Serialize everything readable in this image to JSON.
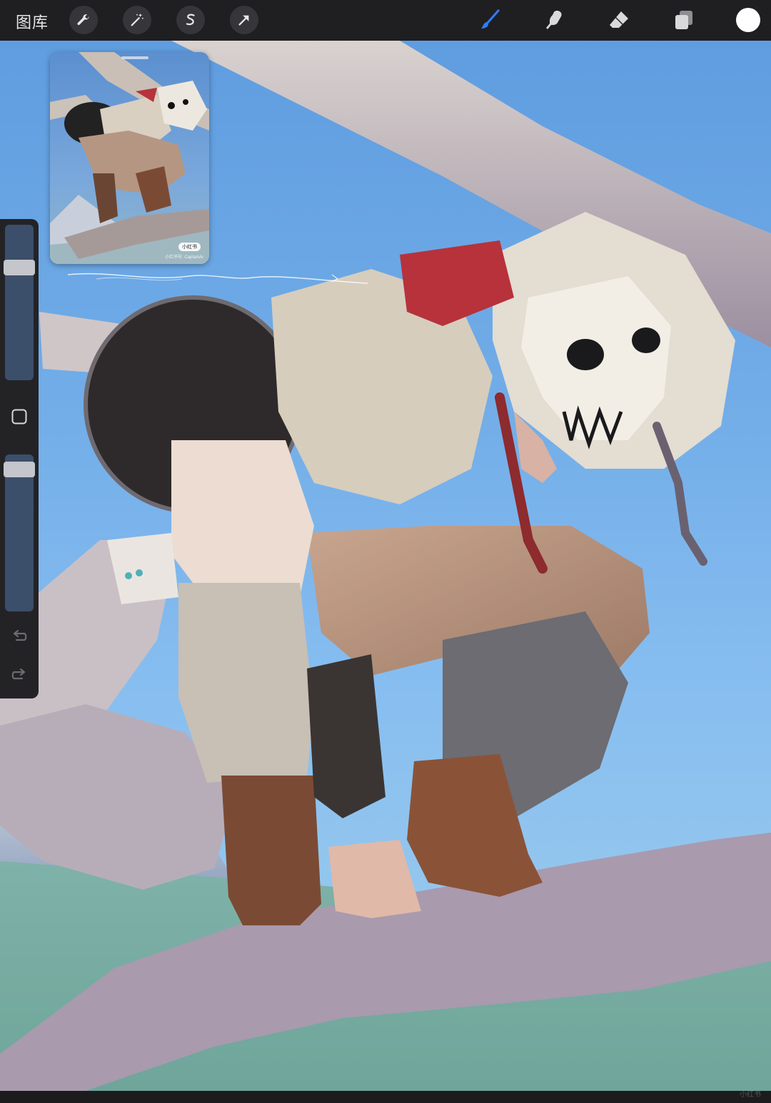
{
  "toolbar": {
    "gallery_label": "图库",
    "left_tools": [
      {
        "name": "actions",
        "icon": "wrench-icon"
      },
      {
        "name": "adjustments",
        "icon": "magic-wand-icon"
      },
      {
        "name": "selection",
        "icon": "selection-s-icon"
      },
      {
        "name": "transform",
        "icon": "arrow-cursor-icon"
      }
    ],
    "right_tools": [
      {
        "name": "brush",
        "icon": "brush-icon",
        "active": true,
        "color": "#2f7bf5"
      },
      {
        "name": "smudge",
        "icon": "smudge-finger-icon",
        "active": false
      },
      {
        "name": "eraser",
        "icon": "eraser-icon",
        "active": false
      },
      {
        "name": "layers",
        "icon": "layers-icon",
        "active": false
      }
    ],
    "current_color": "#ffffff"
  },
  "reference_window": {
    "badge": "小红书",
    "credit": "小红书号: CaptainAr"
  },
  "sidebar": {
    "brush_size_level": 0.75,
    "opacity_level": 0.95,
    "modify_icon": "square-icon",
    "undo_icon": "undo-arrow-icon",
    "redo_icon": "redo-arrow-icon"
  },
  "colors": {
    "toolbar_bg": "#1f1f21",
    "accent": "#2f7bf5",
    "sky": "#72ade8"
  },
  "watermark": "小红书"
}
